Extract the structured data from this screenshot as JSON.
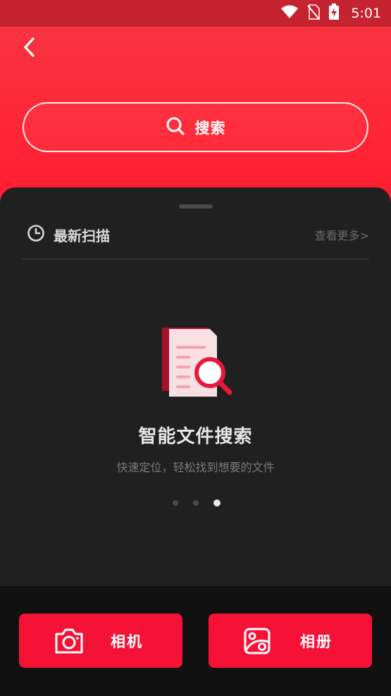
{
  "status_bar": {
    "time": "5:01",
    "icons": [
      "wifi-icon",
      "no-sim-icon",
      "battery-charging-icon"
    ]
  },
  "header": {
    "back_icon": "chevron-left-icon",
    "search": {
      "icon": "search-icon",
      "label": "搜索"
    }
  },
  "recent": {
    "icon": "clock-icon",
    "title": "最新扫描",
    "view_more": "查看更多>"
  },
  "empty_state": {
    "illustration": "document-search-icon",
    "title": "智能文件搜索",
    "subtitle": "快速定位，轻松找到想要的文件",
    "pager": {
      "count": 3,
      "active_index": 2
    }
  },
  "actions": {
    "camera": {
      "icon": "camera-icon",
      "label": "相机"
    },
    "album": {
      "icon": "image-icon",
      "label": "相册"
    }
  },
  "colors": {
    "brand_red": "#ff1c33",
    "button_red": "#f51236",
    "sheet_bg": "#202020",
    "bottom_bg": "#111111"
  }
}
